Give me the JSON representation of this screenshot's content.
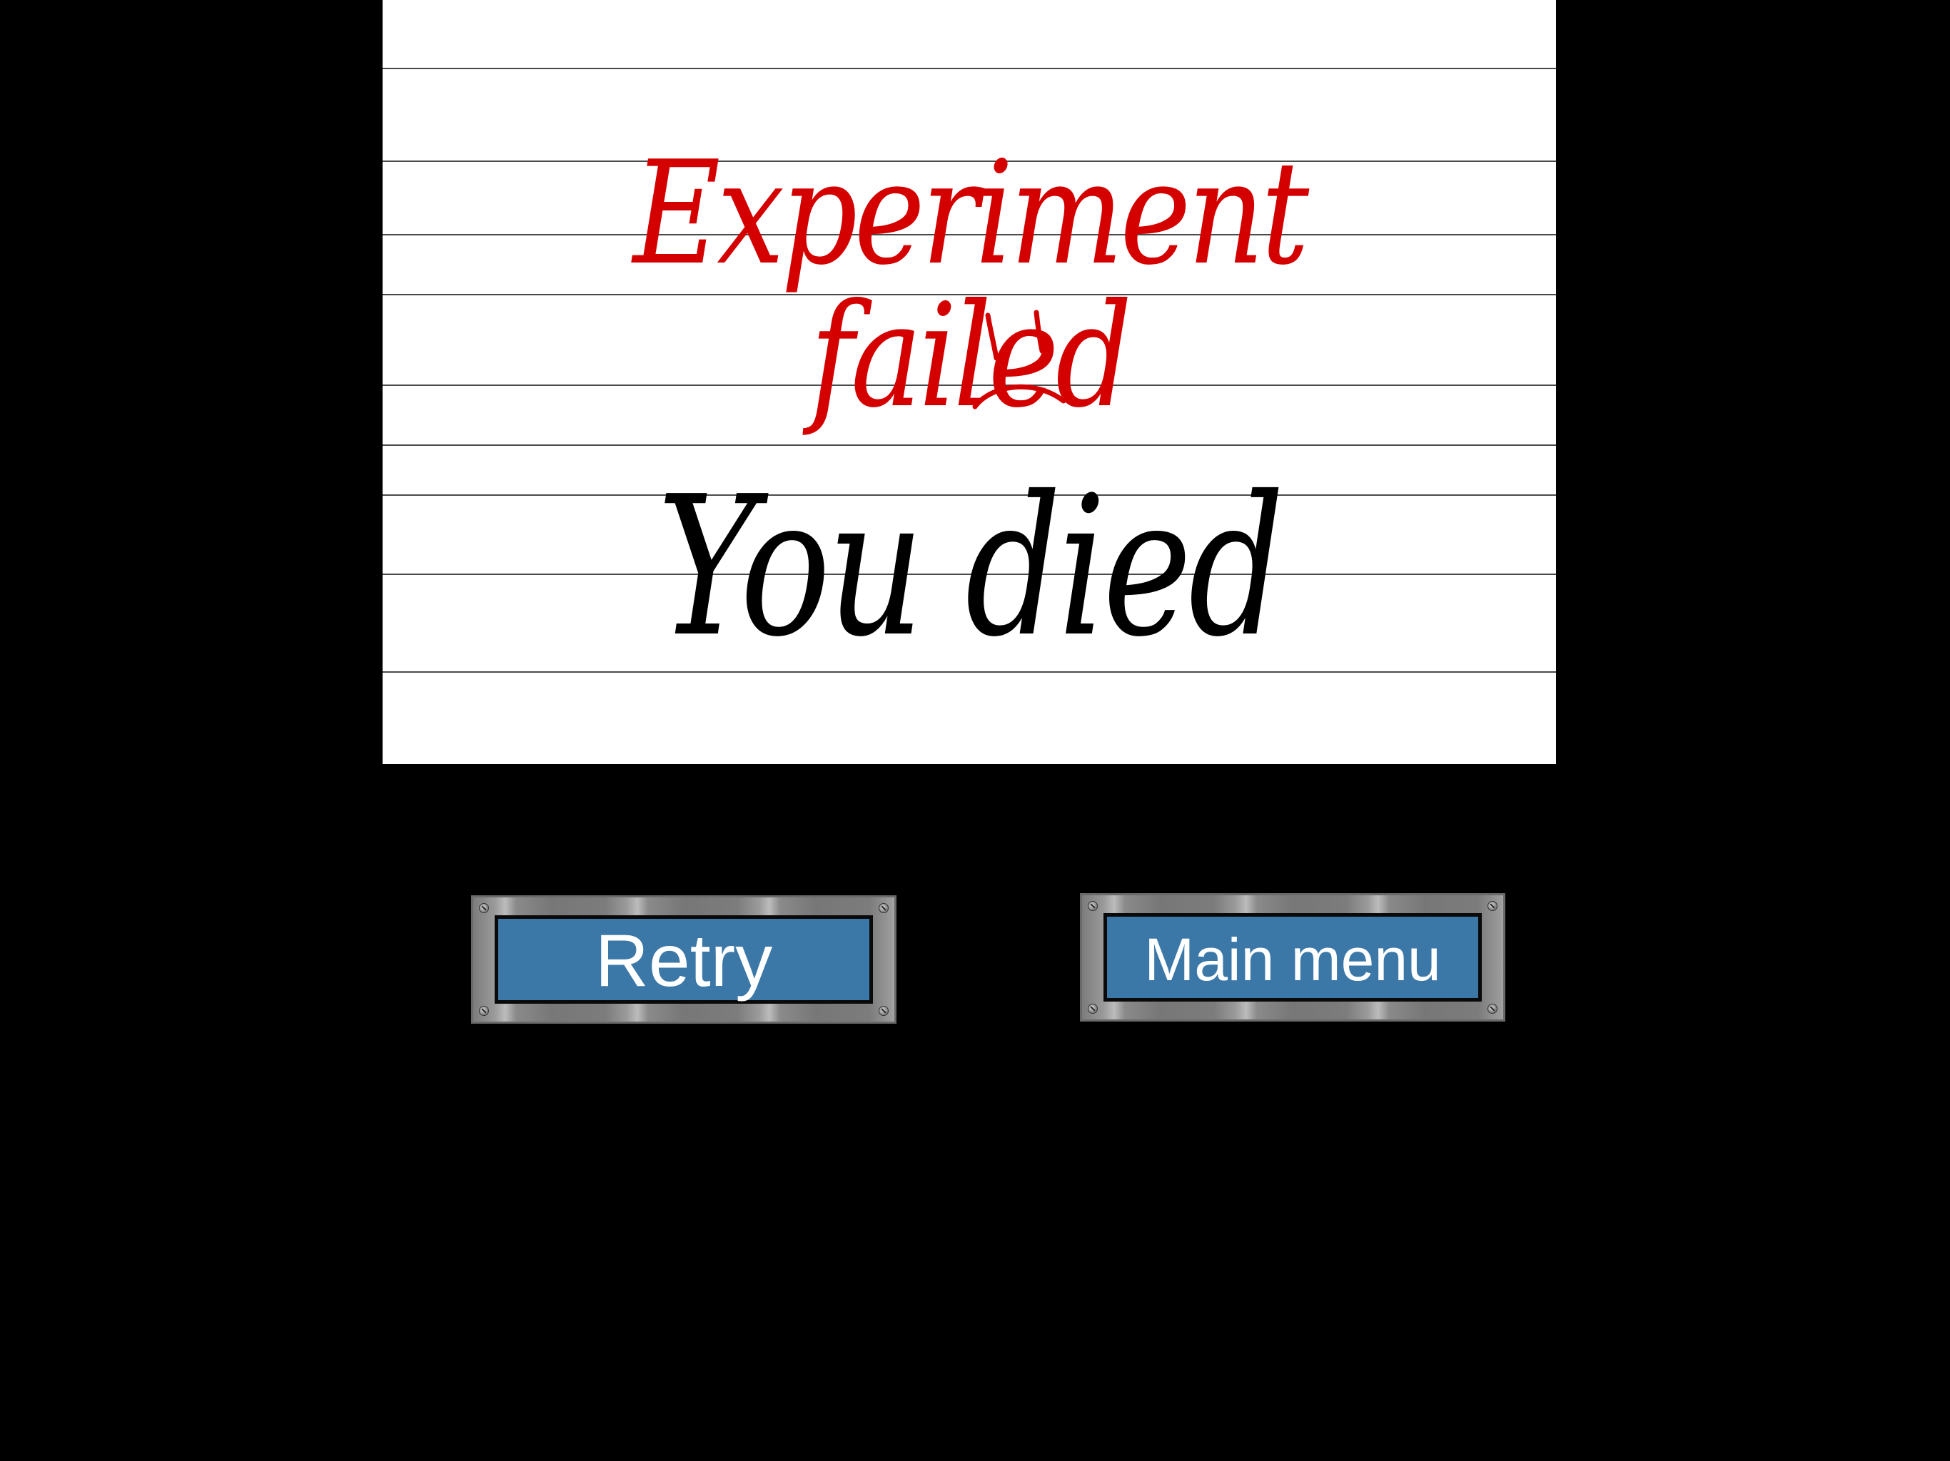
{
  "screen": {
    "title": "Experiment failed",
    "message": "You died",
    "title_color": "#d40000",
    "message_color": "#000000",
    "sad_face_icon": "sad-face-icon"
  },
  "buttons": {
    "retry_label": "Retry",
    "main_menu_label": "Main menu",
    "button_color": "#3b78a8",
    "frame_color": "#8a8a8a"
  }
}
